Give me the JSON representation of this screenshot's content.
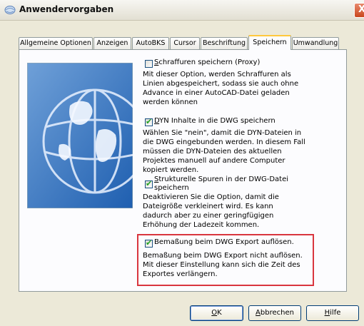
{
  "window": {
    "title": "Anwendervorgaben",
    "close_label": "X"
  },
  "tabs": [
    {
      "label": "Allgemeine Optionen"
    },
    {
      "label": "Anzeigen"
    },
    {
      "label": "AutoBKS"
    },
    {
      "label": "Cursor"
    },
    {
      "label": "Beschriftung"
    },
    {
      "label": "Speichern",
      "active": true
    },
    {
      "label": "Umwandlung"
    }
  ],
  "options": [
    {
      "label_first": "S",
      "label_rest": "chraffuren speichern (Proxy)",
      "checked": false,
      "description": "Mit dieser Option, werden Schraffuren als Linien abgespeichert, sodass sie auch ohne Advance in einer AutoCAD-Datei geladen werden können"
    },
    {
      "label_first": "D",
      "label_rest": "YN Inhalte in die DWG speichern",
      "checked": true,
      "description": "Wählen Sie \"nein\", damit die DYN-Dateien in die DWG eingebunden werden. In diesem Fall müssen die DYN-Dateien des aktuellen Projektes manuell auf andere Computer kopiert werden."
    },
    {
      "label_first": "S",
      "label_rest": "trukturelle Spuren in der DWG-Datei",
      "label_line2": "speichern",
      "checked": true,
      "description": "Deaktivieren Sie die Option, damit die Dateigröße verkleinert wird. Es kann dadurch aber zu einer geringfügigen Erhöhung der Ladezeit kommen."
    },
    {
      "label": "Bemaßung beim DWG Export auflösen.",
      "checked": true,
      "description": "Bemaßung beim DWG Export nicht auflösen. Mit dieser Einstellung kann sich die Zeit des Exportes verlängern."
    }
  ],
  "buttons": {
    "ok_u": "O",
    "ok_rest": "K",
    "cancel_u": "A",
    "cancel_rest": "bbrechen",
    "help_u": "H",
    "help_rest": "ilfe"
  },
  "check_mark": "✔"
}
